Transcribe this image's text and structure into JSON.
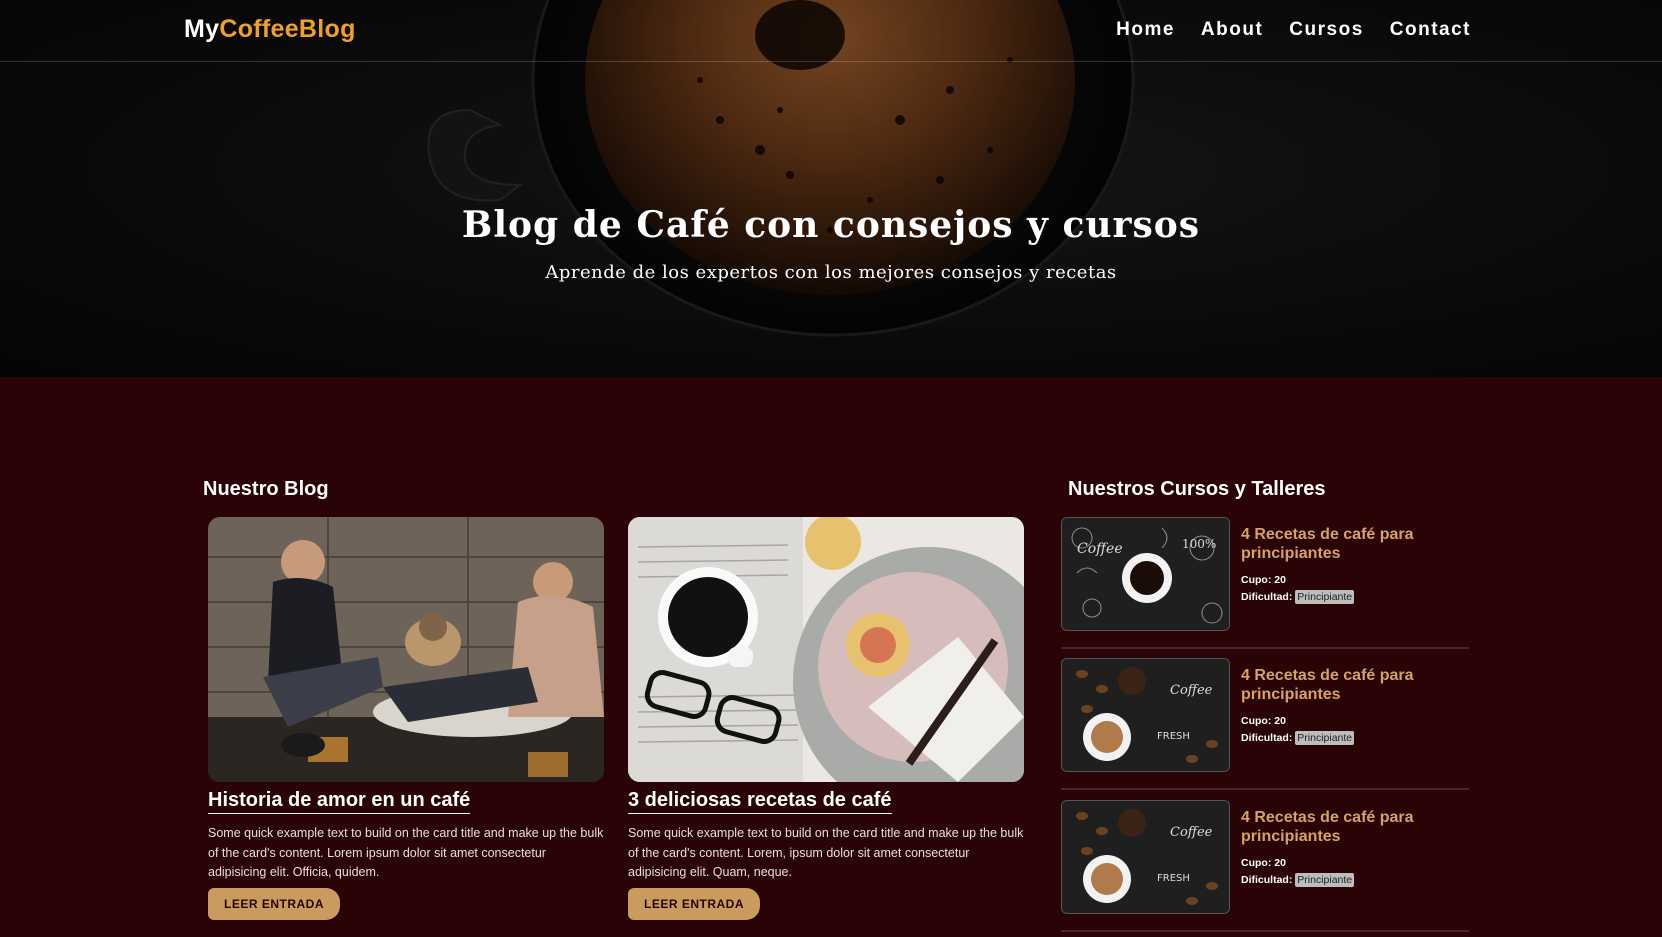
{
  "navbar": {
    "logo_part1": "My",
    "logo_part2": "CoffeeBlog",
    "links": [
      "Home",
      "About",
      "Cursos",
      "Contact"
    ]
  },
  "hero": {
    "title": "Blog de Café con consejos y cursos",
    "subtitle": "Aprende de los expertos con los mejores consejos y recetas"
  },
  "blog": {
    "section_title": "Nuestro Blog",
    "cards": [
      {
        "title": "Historia de amor en un café",
        "text": "Some quick example text to build on the card title and make up the bulk of the card's content. Lorem ipsum dolor sit amet consectetur adipisicing elit. Officia, quidem.",
        "button": "LEER ENTRADA"
      },
      {
        "title": "3 deliciosas recetas de café",
        "text": "Some quick example text to build on the card title and make up the bulk of the card's content. Lorem, ipsum dolor sit amet consectetur adipisicing elit. Quam, neque.",
        "button": "LEER ENTRADA"
      }
    ]
  },
  "courses": {
    "section_title": "Nuestros Cursos y Talleres",
    "items": [
      {
        "title": "4 Recetas de café para principiantes",
        "cupo_label": "Cupo:",
        "cupo_value": "20",
        "dificultad_label": "Dificultad:",
        "dificultad_value": "Principiante"
      },
      {
        "title": "4 Recetas de café para principiantes",
        "cupo_label": "Cupo:",
        "cupo_value": "20",
        "dificultad_label": "Dificultad:",
        "dificultad_value": "Principiante"
      },
      {
        "title": "4 Recetas de café para principiantes",
        "cupo_label": "Cupo:",
        "cupo_value": "20",
        "dificultad_label": "Dificultad:",
        "dificultad_value": "Principiante"
      }
    ]
  },
  "colors": {
    "background": "#2a0306",
    "accent": "#f0a024",
    "course_title": "#d6a266",
    "button": "#c99b5e"
  }
}
